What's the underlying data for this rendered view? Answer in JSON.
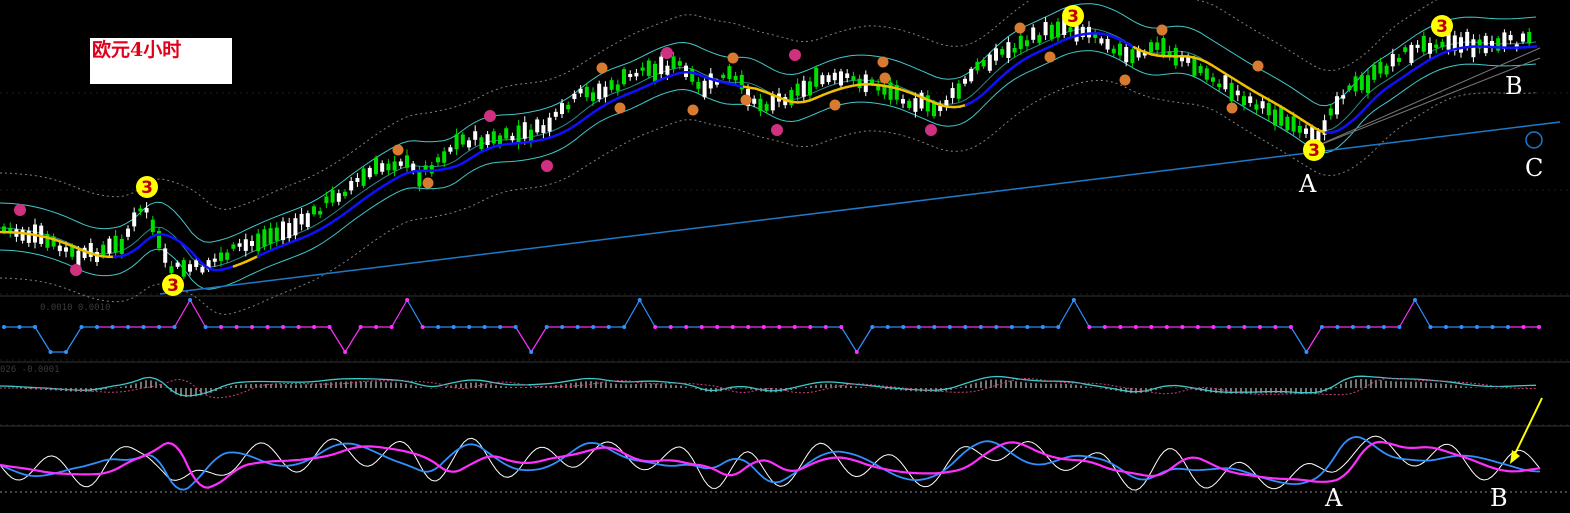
{
  "title": "欧元4小时",
  "panel_info": {
    "main": "",
    "wave": "0.0010 0.0010",
    "macd": "026 -0.0001",
    "stoch": ""
  },
  "point_labels": {
    "main_A": "A",
    "main_B": "B",
    "main_C": "C",
    "osc_A": "A",
    "osc_B": "B"
  },
  "colors": {
    "background": "#000000",
    "bull_candle": "#00e000",
    "bear_candle": "#ffffff",
    "blue_ma": "#1010ff",
    "yellow_ma": "#f0c000",
    "cyan_band": "#40c8c8",
    "outer_band": "#808080",
    "trendline": "#1e7ac8",
    "wave_up": "#3090ff",
    "wave_down": "#ff30ff",
    "stoch_fast": "#ffffff",
    "stoch_mid": "#3090ff",
    "stoch_slow": "#ff30ff",
    "marker_3": "#ffff00",
    "marker_orange": "#d87a30",
    "marker_pink": "#d03080"
  },
  "chart_data": [
    {
      "type": "candlestick",
      "title": "欧元4小时",
      "ylim": [
        0,
        100
      ],
      "trend_ma": [
        {
          "x": 0,
          "y": 38
        },
        {
          "x": 8,
          "y": 36
        },
        {
          "x": 14,
          "y": 40
        },
        {
          "x": 20,
          "y": 46
        },
        {
          "x": 27,
          "y": 60
        },
        {
          "x": 35,
          "y": 66
        },
        {
          "x": 43,
          "y": 78
        },
        {
          "x": 50,
          "y": 80
        },
        {
          "x": 56,
          "y": 78
        },
        {
          "x": 62,
          "y": 72
        },
        {
          "x": 68,
          "y": 88
        },
        {
          "x": 73,
          "y": 92
        },
        {
          "x": 78,
          "y": 90
        },
        {
          "x": 84,
          "y": 72
        },
        {
          "x": 88,
          "y": 72
        },
        {
          "x": 94,
          "y": 80
        },
        {
          "x": 100,
          "y": 88
        }
      ],
      "trendline": [
        {
          "x": 10,
          "y": 2
        },
        {
          "x": 100,
          "y": 58
        }
      ],
      "wave_markers": [
        {
          "x": 10.8,
          "y": 6,
          "label": "3",
          "kind": "major"
        },
        {
          "x": 9.4,
          "y": 38,
          "label": "3",
          "kind": "major"
        },
        {
          "x": 68.5,
          "y": 98,
          "label": "3",
          "kind": "major"
        },
        {
          "x": 83.7,
          "y": 48,
          "label": "3",
          "kind": "major"
        },
        {
          "x": 91.8,
          "y": 96,
          "label": "3",
          "kind": "major"
        }
      ]
    },
    {
      "type": "line",
      "name": "wave-state",
      "series": [
        {
          "name": "",
          "values": [
            1,
            1,
            1,
            0,
            0,
            1,
            1,
            1,
            1,
            1,
            1,
            1,
            2,
            1,
            1,
            1,
            1,
            1,
            1,
            1,
            1,
            1,
            0,
            1,
            1,
            1,
            2,
            1,
            1,
            1,
            1,
            1,
            1,
            1,
            0,
            1,
            1,
            1,
            1,
            1,
            1,
            2,
            1,
            1,
            1,
            1,
            1,
            1,
            1,
            1,
            1,
            1,
            1,
            1,
            1,
            0,
            1,
            1,
            1,
            1,
            1,
            1,
            1,
            1,
            1,
            1,
            1,
            1,
            1,
            2,
            1,
            1,
            1,
            1,
            1,
            1,
            1,
            1,
            1,
            1,
            1,
            1,
            1,
            1,
            0,
            1,
            1,
            1,
            1,
            1,
            1,
            2,
            1,
            1,
            1,
            1,
            1,
            1,
            1,
            1
          ]
        }
      ]
    },
    {
      "type": "line",
      "name": "macd",
      "ylim": [
        -1,
        1
      ]
    },
    {
      "type": "line",
      "name": "stochastic",
      "ylim": [
        0,
        100
      ]
    }
  ]
}
